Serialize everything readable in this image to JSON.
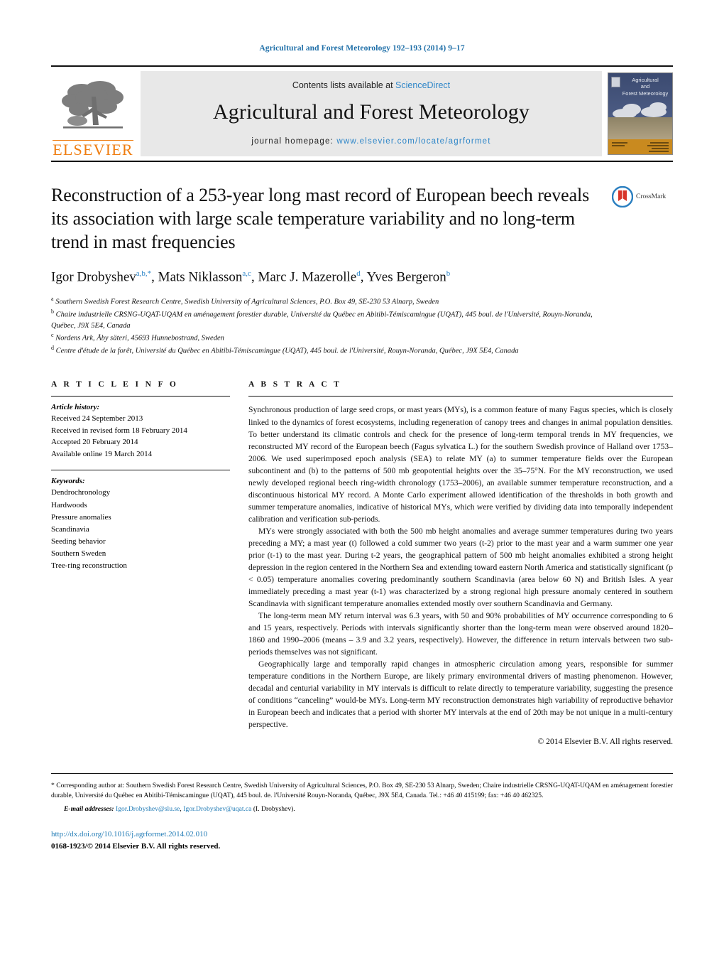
{
  "running_head": "Agricultural and Forest Meteorology 192–193 (2014) 9–17",
  "masthead": {
    "publisher_wordmark": "ELSEVIER",
    "contents_prefix": "Contents lists available at ",
    "contents_link": "ScienceDirect",
    "journal_title": "Agricultural and Forest Meteorology",
    "homepage_prefix": "journal homepage: ",
    "homepage_url": "www.elsevier.com/locate/agrformet",
    "cover_title_line1": "Agricultural",
    "cover_title_line2": "and",
    "cover_title_line3": "Forest Meteorology"
  },
  "article": {
    "title": "Reconstruction of a 253-year long mast record of European beech reveals its association with large scale temperature variability and no long-term trend in mast frequencies",
    "crossmark_label": "CrossMark",
    "authors": [
      {
        "name": "Igor Drobyshev",
        "marks": "a,b,*"
      },
      {
        "name": "Mats Niklasson",
        "marks": "a,c"
      },
      {
        "name": "Marc J. Mazerolle",
        "marks": "d"
      },
      {
        "name": "Yves Bergeron",
        "marks": "b"
      }
    ],
    "affiliations": [
      {
        "mark": "a",
        "text": "Southern Swedish Forest Research Centre, Swedish University of Agricultural Sciences, P.O. Box 49, SE-230 53 Alnarp, Sweden"
      },
      {
        "mark": "b",
        "text": "Chaire industrielle CRSNG-UQAT-UQAM en aménagement forestier durable, Université du Québec en Abitibi-Témiscamingue (UQAT), 445 boul. de l'Université, Rouyn-Noranda, Québec, J9X 5E4, Canada"
      },
      {
        "mark": "c",
        "text": "Nordens Ark, Åby säteri, 45693 Hunnebostrand, Sweden"
      },
      {
        "mark": "d",
        "text": "Centre d'étude de la forêt, Université du Québec en Abitibi-Témiscamingue (UQAT), 445 boul. de l'Université, Rouyn-Noranda, Québec, J9X 5E4, Canada"
      }
    ]
  },
  "article_info": {
    "heading": "A R T I C L E    I N F O",
    "history_label": "Article history:",
    "history": [
      "Received 24 September 2013",
      "Received in revised form 18 February 2014",
      "Accepted 20 February 2014",
      "Available online 19 March 2014"
    ],
    "keywords_label": "Keywords:",
    "keywords": [
      "Dendrochronology",
      "Hardwoods",
      "Pressure anomalies",
      "Scandinavia",
      "Seeding behavior",
      "Southern Sweden",
      "Tree-ring reconstruction"
    ]
  },
  "abstract": {
    "heading": "A B S T R A C T",
    "paragraphs": [
      "Synchronous production of large seed crops, or mast years (MYs), is a common feature of many Fagus species, which is closely linked to the dynamics of forest ecosystems, including regeneration of canopy trees and changes in animal population densities. To better understand its climatic controls and check for the presence of long-term temporal trends in MY frequencies, we reconstructed MY record of the European beech (Fagus sylvatica L.) for the southern Swedish province of Halland over 1753–2006. We used superimposed epoch analysis (SEA) to relate MY (a) to summer temperature fields over the European subcontinent and (b) to the patterns of 500 mb geopotential heights over the 35–75°N. For the MY reconstruction, we used newly developed regional beech ring-width chronology (1753–2006), an available summer temperature reconstruction, and a discontinuous historical MY record. A Monte Carlo experiment allowed identification of the thresholds in both growth and summer temperature anomalies, indicative of historical MYs, which were verified by dividing data into temporally independent calibration and verification sub-periods.",
      "MYs were strongly associated with both the 500 mb height anomalies and average summer temperatures during two years preceding a MY; a mast year (t) followed a cold summer two years (t-2) prior to the mast year and a warm summer one year prior (t-1) to the mast year. During t-2 years, the geographical pattern of 500 mb height anomalies exhibited a strong height depression in the region centered in the Northern Sea and extending toward eastern North America and statistically significant (p < 0.05) temperature anomalies covering predominantly southern Scandinavia (area below 60 N) and British Isles. A year immediately preceding a mast year (t-1) was characterized by a strong regional high pressure anomaly centered in southern Scandinavia with significant temperature anomalies extended mostly over southern Scandinavia and Germany.",
      "The long-term mean MY return interval was 6.3 years, with 50 and 90% probabilities of MY occurrence corresponding to 6 and 15 years, respectively. Periods with intervals significantly shorter than the long-term mean were observed around 1820–1860 and 1990–2006 (means – 3.9 and 3.2 years, respectively). However, the difference in return intervals between two sub-periods themselves was not significant.",
      "Geographically large and temporally rapid changes in atmospheric circulation among years, responsible for summer temperature conditions in the Northern Europe, are likely primary environmental drivers of masting phenomenon. However, decadal and centurial variability in MY intervals is difficult to relate directly to temperature variability, suggesting the presence of conditions “canceling” would-be MYs. Long-term MY reconstruction demonstrates high variability of reproductive behavior in European beech and indicates that a period with shorter MY intervals at the end of 20th may be not unique in a multi-century perspective."
    ],
    "copyright": "© 2014 Elsevier B.V. All rights reserved."
  },
  "footer": {
    "corresponding_note": "* Corresponding author at: Southern Swedish Forest Research Centre, Swedish University of Agricultural Sciences, P.O. Box 49, SE-230 53 Alnarp, Sweden; Chaire industrielle CRSNG-UQAT-UQAM en aménagement forestier durable, Université du Québec en Abitibi-Témiscamingue (UQAT), 445 boul. de. l'Université Rouyn-Noranda, Québec, J9X 5E4, Canada. Tel.: +46 40 415199; fax: +46 40 462325.",
    "email_label": "E-mail addresses:",
    "email_1": "Igor.Drobyshev@slu.se",
    "email_2": "Igor.Drobyshev@uqat.ca",
    "email_suffix": "(I. Drobyshev).",
    "doi": "http://dx.doi.org/10.1016/j.agrformet.2014.02.010",
    "issn_line": "0168-1923/© 2014 Elsevier B.V. All rights reserved."
  },
  "colors": {
    "link": "#1f7ab5",
    "running_head": "#1f6fa8",
    "elsevier_orange": "#ef7d10",
    "masthead_bg": "#e8e8e8"
  }
}
